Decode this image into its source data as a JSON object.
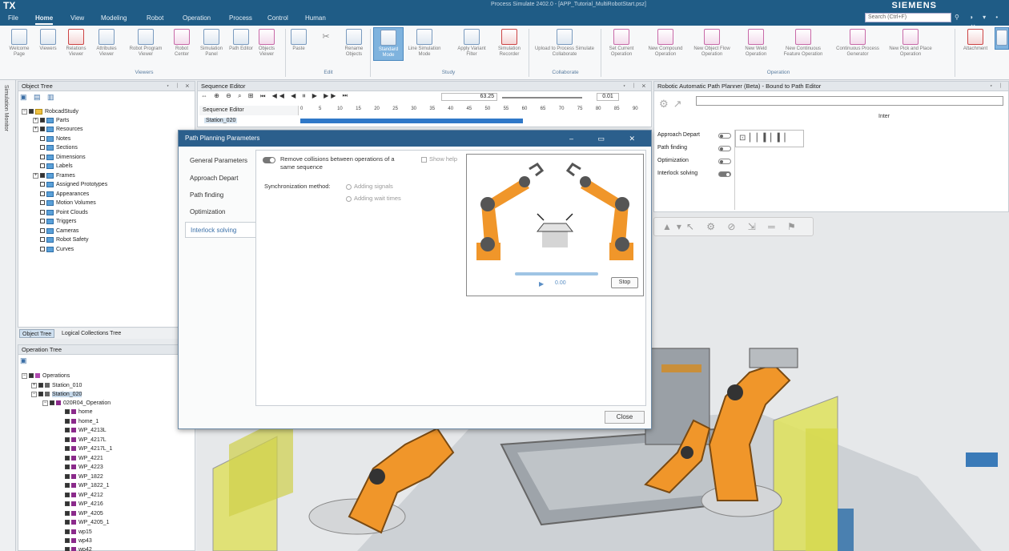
{
  "app": {
    "logo": "TX",
    "title": "Process Simulate 2402.0 - [APP_Tutorial_MultiRobotStart.psz]",
    "brand": "SIEMENS",
    "search_placeholder": "Search (Ctrl+F)"
  },
  "menu": [
    "File",
    "Home",
    "View",
    "Modeling",
    "Robot",
    "Operation",
    "Process",
    "Control",
    "Human"
  ],
  "ribbon": {
    "buttons": [
      {
        "label": "Welcome Page"
      },
      {
        "label": "Viewers"
      },
      {
        "label": "Relations Viewer"
      },
      {
        "label": "Attributes Viewer"
      },
      {
        "label": "Robot Program Viewer"
      },
      {
        "label": "Robot Center"
      },
      {
        "label": "Simulation Panel"
      },
      {
        "label": "Path Editor"
      },
      {
        "label": "Objects Viewer"
      },
      {
        "label": "Paste"
      },
      {
        "label": "Rename Objects"
      },
      {
        "label": "Standard Mode"
      },
      {
        "label": "Line Simulation Mode"
      },
      {
        "label": "Apply Variant Filter"
      },
      {
        "label": "Simulation Recorder"
      },
      {
        "label": "Upload to Process Simulate Collaborate"
      },
      {
        "label": "Set Current Operation"
      },
      {
        "label": "New Compound Operation"
      },
      {
        "label": "New Object Flow Operation"
      },
      {
        "label": "New Weld Operation"
      },
      {
        "label": "New Continuous Feature Operation"
      },
      {
        "label": "Continuous Process Generator"
      },
      {
        "label": "New Pick and Place Operation"
      },
      {
        "label": "Attachment"
      }
    ],
    "groups": [
      "Viewers",
      "Edit",
      "Study",
      "Collaborate",
      "Operation"
    ]
  },
  "side_strip": "Simulation Monitor",
  "object_tree": {
    "title": "Object Tree",
    "root": "RobcadStudy",
    "items": [
      "Parts",
      "Resources",
      "Notes",
      "Sections",
      "Dimensions",
      "Labels",
      "Frames",
      "Assigned Prototypes",
      "Appearances",
      "Motion Volumes",
      "Point Clouds",
      "Triggers",
      "Cameras",
      "Robot Safety",
      "Curves"
    ],
    "tabs": [
      "Object Tree",
      "Logical Collections Tree"
    ]
  },
  "operation_tree": {
    "title": "Operation Tree",
    "root": "Operations",
    "stations": [
      "Station_010",
      "Station_020"
    ],
    "operation": "020R04_Operation",
    "items": [
      "home",
      "home_1",
      "WP_4213L",
      "WP_4217L",
      "WP_4217L_1",
      "WP_4221",
      "WP_4223",
      "WP_1822",
      "WP_1822_1",
      "WP_4212",
      "WP_4216",
      "WP_4205",
      "WP_4205_1",
      "wp15",
      "wp43",
      "wp42"
    ]
  },
  "sequence_editor": {
    "title": "Sequence Editor",
    "column": "Sequence Editor",
    "row": "Station_020",
    "time": "63.25",
    "speed": "0.01",
    "ticks": [
      "0",
      "5",
      "10",
      "15",
      "20",
      "25",
      "30",
      "35",
      "40",
      "45",
      "50",
      "55",
      "60",
      "65",
      "70",
      "75",
      "80",
      "85",
      "90"
    ]
  },
  "path_planner": {
    "title": "Robotic Automatic Path Planner (Beta) - Bound to Path Editor",
    "progress_label": "Inter",
    "options": [
      {
        "label": "Approach Depart",
        "on": false
      },
      {
        "label": "Path finding",
        "on": false
      },
      {
        "label": "Optimization",
        "on": false
      },
      {
        "label": "Interlock solving",
        "on": true
      }
    ]
  },
  "dialog": {
    "title": "Path Planning Parameters",
    "nav": [
      "General Parameters",
      "Approach Depart",
      "Path finding",
      "Optimization",
      "Interlock solving"
    ],
    "active_nav": 4,
    "remove_collisions": "Remove collisions between operations of a same sequence",
    "show_help": "Show help",
    "sync_label": "Synchronization method:",
    "radio_signals": "Adding signals",
    "radio_wait": "Adding wait times",
    "help_time": "0.00",
    "stop_label": "Stop",
    "close_label": "Close"
  },
  "colors": {
    "title_bar": "#1f5c86",
    "dialog_title": "#2b5f8c",
    "robot_orange": "#f0962a",
    "accent_blue": "#2f78c8"
  }
}
